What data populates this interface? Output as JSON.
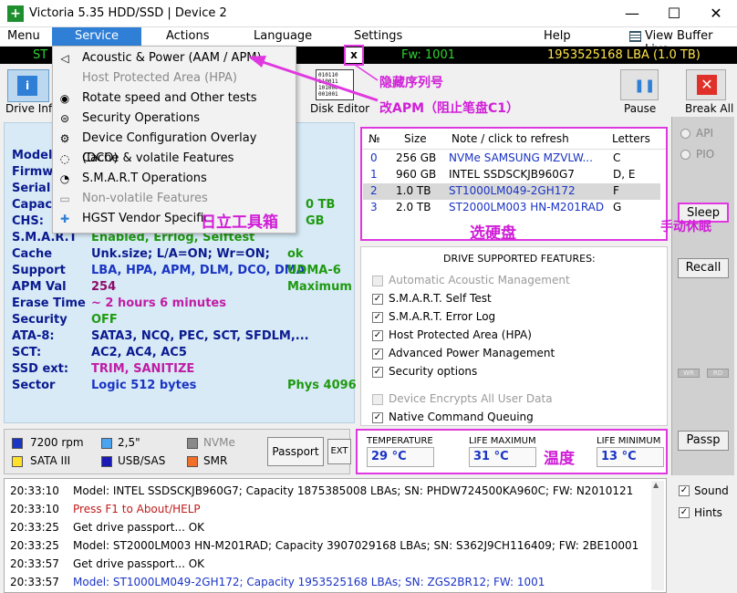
{
  "window": {
    "title": "Victoria 5.35 HDD/SSD | Device 2"
  },
  "menu": {
    "items": [
      "Menu",
      "Service",
      "Actions",
      "Language",
      "Settings",
      "Help"
    ],
    "view_buffer": "View Buffer Live"
  },
  "statusbar": {
    "left": "ST",
    "fw": "Fw: 1001",
    "lba": "1953525168 LBA (1.0 TB)"
  },
  "toolbar": {
    "drive_info": "Drive Info",
    "disk_editor": "Disk Editor",
    "pause": "Pause",
    "break_all": "Break All",
    "disk_icon_text": "010110\n110011\n101000\n001001"
  },
  "service_menu": [
    {
      "label": "Acoustic & Power (AAM / APM)",
      "disabled": false,
      "icon": "speaker-icon",
      "glyph": "◁"
    },
    {
      "label": "Host Protected Area (HPA)",
      "disabled": true,
      "icon": "blank-icon",
      "glyph": ""
    },
    {
      "label": "Rotate speed and Other tests",
      "disabled": false,
      "icon": "disk-icon",
      "glyph": "◉"
    },
    {
      "label": "Security Operations",
      "disabled": false,
      "icon": "lock-icon",
      "glyph": "⊜"
    },
    {
      "label": "Device Configuration Overlay (DCO)",
      "disabled": false,
      "icon": "gear-icon",
      "glyph": "⚙"
    },
    {
      "label": "Cache & volatile Features",
      "disabled": false,
      "icon": "cache-icon",
      "glyph": "◌"
    },
    {
      "label": "S.M.A.R.T Operations",
      "disabled": false,
      "icon": "smart-icon",
      "glyph": "◔"
    },
    {
      "label": "Non-volatile Features",
      "disabled": true,
      "icon": "chip-icon",
      "glyph": "▭"
    },
    {
      "label": "HGST Vendor Specific",
      "disabled": false,
      "icon": "plus-icon",
      "glyph": "✚"
    }
  ],
  "info": {
    "labels": [
      "Model:",
      "Firmware",
      "Serial",
      "Capacity",
      "CHS:",
      "S.M.A.R.T",
      "Cache",
      "Support",
      "APM Val",
      "Erase Time",
      "Security",
      "ATA-8:",
      "SCT:",
      "SSD ext:",
      "Sector"
    ],
    "capacity_tail": "0 TB",
    "chs_tail": "GB",
    "smart": "Enabled, Errlog, Selftest",
    "cache": "Unk.size; L/A=ON; Wr=ON;",
    "cache_status": "ok",
    "support": "LBA, HPA, APM, DLM, DCO, DMA",
    "support_mode": "UDMA-6",
    "apm": "254",
    "apm_mode": "Maximum",
    "erase": "~ 2 hours 6 minutes",
    "security": "OFF",
    "ata8": "SATA3, NCQ, PEC, SCT, SFDLM,...",
    "sct": "AC2, AC4, AC5",
    "ssd_ext": "TRIM, SANITIZE",
    "sector": "Logic 512 bytes",
    "phys": "Phys 4096"
  },
  "drives": {
    "headers": [
      "№",
      "Size",
      "Note / click to refresh",
      "Letters"
    ],
    "rows": [
      {
        "n": "0",
        "size": "256 GB",
        "note": "NVMe    SAMSUNG MZVLW...",
        "letters": "C",
        "selected": false
      },
      {
        "n": "1",
        "size": "960 GB",
        "note": "INTEL SSDSCKJB960G7",
        "letters": "D, E",
        "selected": false
      },
      {
        "n": "2",
        "size": "1.0 TB",
        "note": "ST1000LM049-2GH172",
        "letters": "F",
        "selected": true
      },
      {
        "n": "3",
        "size": "2.0 TB",
        "note": "ST2000LM003 HN-M201RAD",
        "letters": "G",
        "selected": false
      }
    ]
  },
  "features": {
    "title": "DRIVE SUPPORTED FEATURES:",
    "items": [
      {
        "label": "Automatic Acoustic Management",
        "checked": false,
        "disabled": true
      },
      {
        "label": "S.M.A.R.T. Self Test",
        "checked": true,
        "disabled": false
      },
      {
        "label": "S.M.A.R.T. Error Log",
        "checked": true,
        "disabled": false
      },
      {
        "label": "Host Protected Area (HPA)",
        "checked": true,
        "disabled": false
      },
      {
        "label": "Advanced Power Management",
        "checked": true,
        "disabled": false
      },
      {
        "label": "Security options",
        "checked": true,
        "disabled": false
      },
      {
        "label": "Device Encrypts All User Data",
        "checked": false,
        "disabled": true
      },
      {
        "label": "Native Command Queuing",
        "checked": true,
        "disabled": false
      }
    ]
  },
  "right": {
    "api": "API",
    "pio": "PIO",
    "sleep": "Sleep",
    "recall": "Recall",
    "wr": "WR",
    "rd": "RD",
    "passp": "Passp",
    "sound": "Sound",
    "hints": "Hints"
  },
  "legend": {
    "items": [
      "7200 rpm",
      "2,5\"",
      "NVMe",
      "SATA III",
      "USB/SAS",
      "SMR"
    ],
    "passport": "Passport",
    "ext": "EXT",
    "colors": [
      "#1a34c4",
      "#4aa4f0",
      "#8a8a8a",
      "#ffe02a",
      "#1a1ab4",
      "#f0702a"
    ]
  },
  "temps": {
    "temp_label": "TEMPERATURE",
    "temp": "29 °C",
    "max_label": "LIFE MAXIMUM",
    "max": "31 °C",
    "min_label": "LIFE MINIMUM",
    "min": "13 °C"
  },
  "log": [
    {
      "t": "20:33:10",
      "m": "Model: INTEL SSDSCKJB960G7; Capacity 1875385008 LBAs; SN: PHDW724500KA960C; FW: N2010121",
      "c": "#000"
    },
    {
      "t": "20:33:10",
      "m": "Press F1 to About/HELP",
      "c": "#c01a1a"
    },
    {
      "t": "20:33:25",
      "m": "Get drive passport... OK",
      "c": "#000"
    },
    {
      "t": "20:33:25",
      "m": "Model: ST2000LM003 HN-M201RAD; Capacity 3907029168 LBAs; SN: S362J9CH116409; FW: 2BE10001",
      "c": "#000"
    },
    {
      "t": "20:33:57",
      "m": "Get drive passport... OK",
      "c": "#000"
    },
    {
      "t": "20:33:57",
      "m": "Model: ST1000LM049-2GH172; Capacity 1953525168 LBAs; SN: ZGS2BR12; FW: 1001",
      "c": "#1a34c4"
    }
  ],
  "annotations": {
    "hide_col": "隐藏序列号",
    "apm": "改APM（阻止笔盘C1）",
    "hitachi": "日立工具箱",
    "select": "选硬盘",
    "sleep": "手动休眠",
    "temp": "温度"
  }
}
